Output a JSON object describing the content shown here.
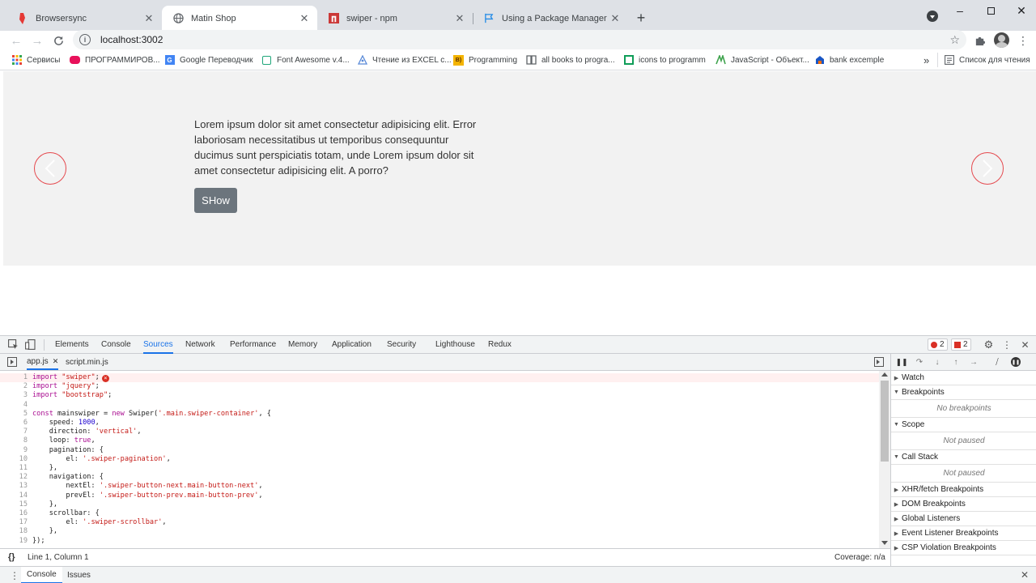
{
  "tabs": [
    {
      "title": "Browsersync",
      "icon": "browsersync-icon"
    },
    {
      "title": "Matin Shop",
      "icon": "globe-icon"
    },
    {
      "title": "swiper - npm",
      "icon": "npm-icon"
    },
    {
      "title": "Using a Package Manager | Font",
      "icon": "fontawesome-flag-icon"
    }
  ],
  "omnibox": {
    "url": "localhost:3002"
  },
  "bookmarks": [
    {
      "label": "Сервисы",
      "icon": "apps-grid-icon",
      "color": "#ea4335"
    },
    {
      "label": "ПРОГРАММИРОВ...",
      "icon": "red-bookmark-icon",
      "color": "#e8115b"
    },
    {
      "label": "Google Переводчик",
      "icon": "google-translate-icon",
      "color": "#4285f4"
    },
    {
      "label": "Font Awesome v.4...",
      "icon": "fontawesome-icon",
      "color": "#1fa67a"
    },
    {
      "label": "Чтение из EXCEL с...",
      "icon": "excel-reader-icon",
      "color": "#5b8bd8"
    },
    {
      "label": "Programming",
      "icon": "programming-icon",
      "color": "#f4b400"
    },
    {
      "label": "all books to progra...",
      "icon": "book-icon",
      "color": "#5f6368"
    },
    {
      "label": "icons to programm",
      "icon": "green-grid-icon",
      "color": "#0f9d58"
    },
    {
      "label": "JavaScript - Объект...",
      "icon": "mdn-icon",
      "color": "#3fa34d"
    },
    {
      "label": "bank excemple",
      "icon": "bank-icon",
      "color": "#1a56c4"
    }
  ],
  "bookmarks_more": "»",
  "reading_list": "Список для чтения",
  "page": {
    "lorem": "Lorem ipsum dolor sit amet consectetur adipisicing elit. Error laboriosam necessitatibus ut temporibus consequuntur ducimus sunt perspiciatis totam, unde Lorem ipsum dolor sit amet consectetur adipisicing elit. A porro?",
    "show_button": "SHow",
    "accent_color": "#e5484d"
  },
  "devtools": {
    "tabs": [
      "Elements",
      "Console",
      "Sources",
      "Network",
      "Performance",
      "Memory",
      "Application",
      "Security",
      "Lighthouse",
      "Redux"
    ],
    "active_tab": "Sources",
    "errors": "2",
    "issues": "2",
    "source_tabs": [
      "app.js",
      "script.min.js"
    ],
    "status_position": "Line 1, Column 1",
    "coverage": "Coverage: n/a",
    "drawer_tabs": [
      "Console",
      "Issues"
    ],
    "sidebar": {
      "watch": "Watch",
      "breakpoints": "Breakpoints",
      "no_breakpoints": "No breakpoints",
      "scope": "Scope",
      "not_paused_1": "Not paused",
      "call_stack": "Call Stack",
      "not_paused_2": "Not paused",
      "xhr": "XHR/fetch Breakpoints",
      "dom": "DOM Breakpoints",
      "global": "Global Listeners",
      "event": "Event Listener Breakpoints",
      "csp": "CSP Violation Breakpoints"
    },
    "code_lines": [
      "import \"swiper\";",
      "import \"jquery\";",
      "import \"bootstrap\";",
      "",
      "const mainswiper = new Swiper('.main.swiper-container', {",
      "    speed: 1000,",
      "    direction: 'vertical',",
      "    loop: true,",
      "    pagination: {",
      "        el: '.swiper-pagination',",
      "    },",
      "    navigation: {",
      "        nextEl: '.swiper-button-next.main-button-next',",
      "        prevEl: '.swiper-button-prev.main-button-prev',",
      "    },",
      "    scrollbar: {",
      "        el: '.swiper-scrollbar',",
      "    },",
      "});"
    ]
  }
}
